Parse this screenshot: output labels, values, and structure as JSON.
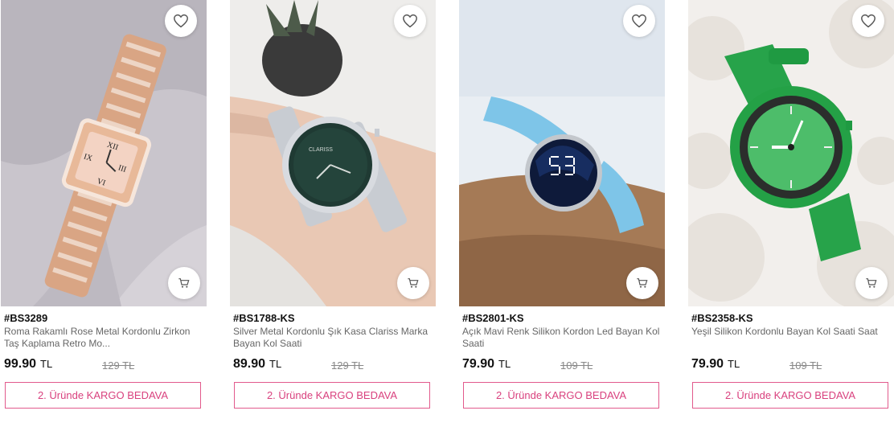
{
  "products": [
    {
      "code": "#BS3289",
      "title": "Roma Rakamlı Rose Metal Kordonlu Zirkon Taş Kaplama Retro Mo...",
      "price": "99.90",
      "currency": "TL",
      "old_price": "129 TL",
      "promo": "2. Üründe KARGO BEDAVA"
    },
    {
      "code": "#BS1788-KS",
      "title": "Silver Metal Kordonlu Şık Kasa Clariss Marka Bayan Kol Saati",
      "price": "89.90",
      "currency": "TL",
      "old_price": "129 TL",
      "promo": "2. Üründe KARGO BEDAVA"
    },
    {
      "code": "#BS2801-KS",
      "title": "Açık Mavi Renk Silikon Kordon Led Bayan Kol Saati",
      "price": "79.90",
      "currency": "TL",
      "old_price": "109 TL",
      "promo": "2. Üründe KARGO BEDAVA"
    },
    {
      "code": "#BS2358-KS",
      "title": "Yeşil Silikon Kordonlu Bayan Kol Saati Saat",
      "price": "79.90",
      "currency": "TL",
      "old_price": "109 TL",
      "promo": "2. Üründe KARGO BEDAVA"
    }
  ],
  "colors": {
    "accent": "#d9417e",
    "promo_border": "#e25a8c"
  },
  "icons": {
    "favorite": "heart-icon",
    "cart": "cart-icon"
  }
}
